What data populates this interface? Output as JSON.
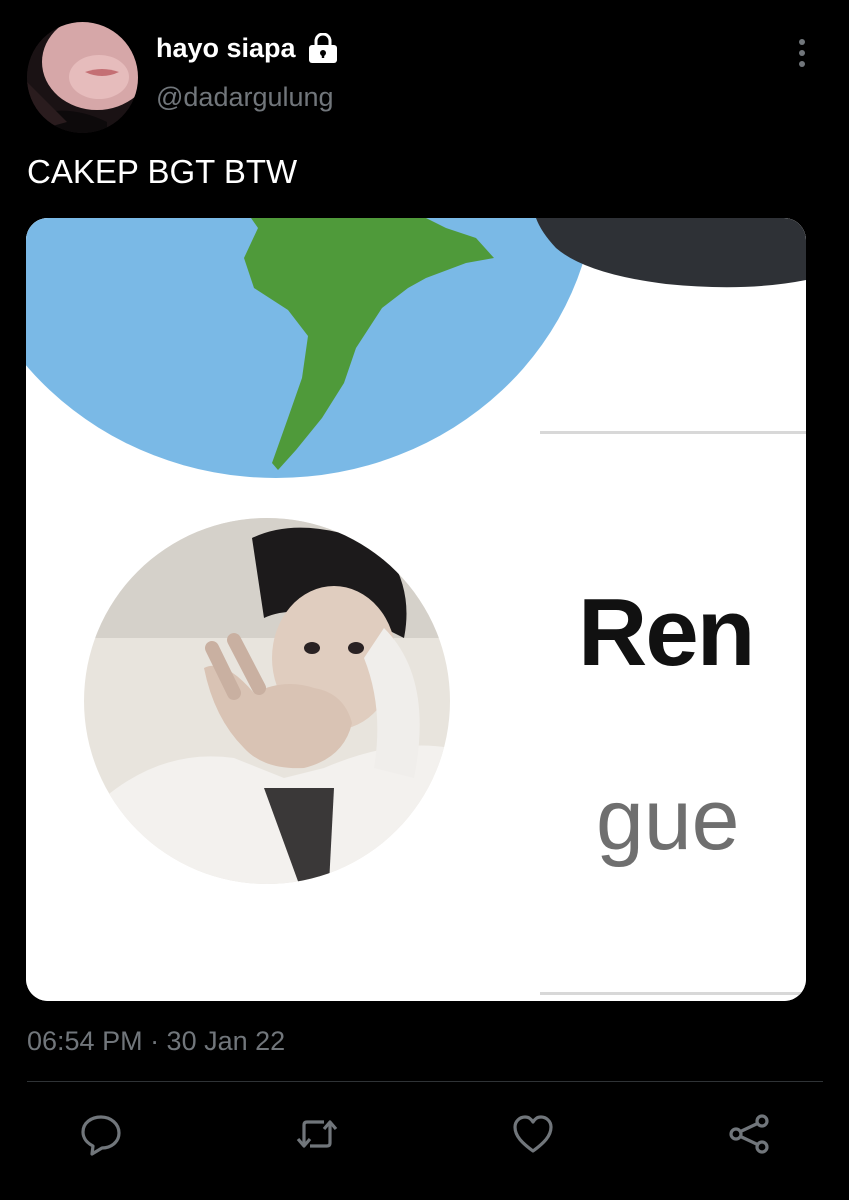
{
  "tweet": {
    "author": {
      "display_name": "hayo siapa",
      "handle": "@dadargulung",
      "protected_icon": "lock-icon"
    },
    "text": "CAKEP BGT BTW",
    "media": {
      "profile_name_fragment": "Ren",
      "bio_fragment": "gue"
    },
    "timestamp": "06:54 PM · 30 Jan 22"
  },
  "actions": [
    {
      "icon": "reply-icon"
    },
    {
      "icon": "retweet-icon"
    },
    {
      "icon": "like-icon"
    },
    {
      "icon": "share-icon"
    }
  ],
  "colors": {
    "background": "#000000",
    "primary_text": "#ffffff",
    "secondary_text": "#71767b",
    "divider": "#2f3336"
  }
}
